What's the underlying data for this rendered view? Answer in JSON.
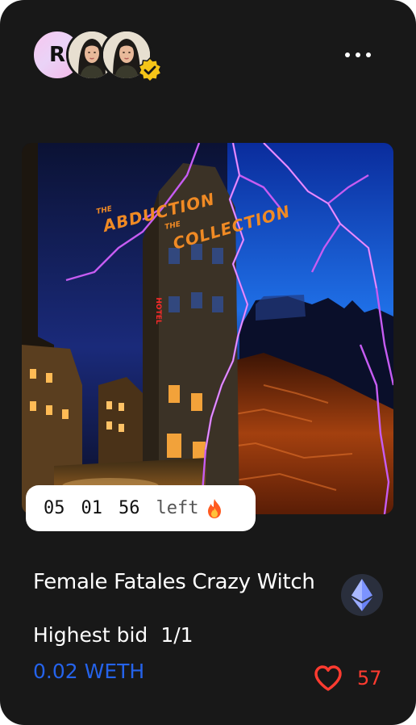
{
  "header": {
    "brand_avatar_letter": "R",
    "avatars": [
      "creator-avatar",
      "owner-avatar"
    ],
    "verified_color": "#f5c518"
  },
  "artwork": {
    "overlay_text_line1_prefix": "THE",
    "overlay_text_line1": "ABDUCTION",
    "overlay_text_line2_prefix": "THE",
    "overlay_text_line2": "COLLECTION",
    "sign_text": "HOTEL"
  },
  "countdown": {
    "hours": "05",
    "minutes": "01",
    "seconds": "56",
    "suffix": "left",
    "icon": "fire-icon"
  },
  "item": {
    "title": "Female Fatales Crazy Witch",
    "currency_icon": "ethereum-icon",
    "bid_label": "Highest bid",
    "edition": "1/1",
    "price": "0.02 WETH",
    "likes": "57"
  },
  "colors": {
    "card_bg": "#181818",
    "price": "#2563eb",
    "like": "#ff3b30",
    "art_text": "#f08a24",
    "lightning": "#c65cf2"
  }
}
